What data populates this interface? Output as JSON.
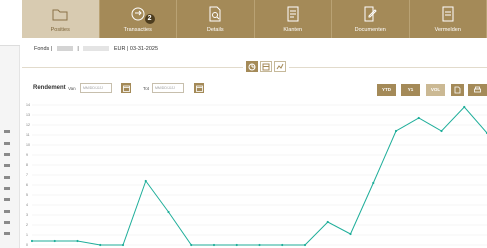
{
  "tabs": [
    {
      "label": "Posities",
      "icon": "folder-icon",
      "active": true
    },
    {
      "label": "Transacties",
      "icon": "transactions-icon",
      "badge": "2"
    },
    {
      "label": "Details",
      "icon": "document-search-icon"
    },
    {
      "label": "Klanten",
      "icon": "clients-icon"
    },
    {
      "label": "Documenten",
      "icon": "document-edit-icon"
    },
    {
      "label": "Vermelden",
      "icon": "report-icon"
    }
  ],
  "fonds": {
    "prefix": "Fonds |",
    "sep": "|",
    "suffix": "EUR | 03-31-2025"
  },
  "filters": {
    "title": "Rendement",
    "from_label": "Van",
    "from_placeholder": "MM/DD/JJJJ",
    "to_label": "Tot",
    "to_placeholder": "MM/DD/JJJJ",
    "periods": [
      "YTD",
      "Y1",
      "VOL"
    ]
  },
  "colors": {
    "accent": "#a48a58",
    "accent_light": "#d8cbb1",
    "line": "#1fae9a",
    "grid": "#ececec"
  },
  "chart_data": {
    "type": "line",
    "ylim": [
      0,
      14
    ],
    "yticks": [
      "0",
      "1",
      "2",
      "3",
      "4",
      "5",
      "6",
      "7",
      "8",
      "9",
      "10",
      "11",
      "12",
      "13",
      "14"
    ],
    "series": [
      {
        "values": [
          0.4,
          0.4,
          0.4,
          0,
          0,
          6.4,
          3.3,
          0,
          0,
          0,
          0,
          0,
          0,
          2.3,
          1.1,
          6.2,
          11.4,
          12.7,
          11.4,
          13.8,
          11.2
        ]
      }
    ]
  }
}
